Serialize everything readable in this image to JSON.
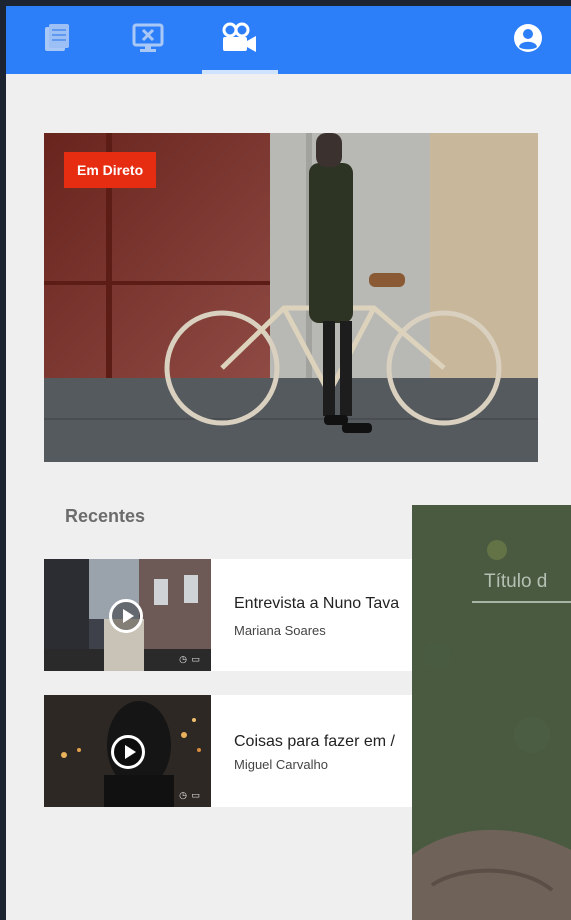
{
  "nav": {
    "tabs": [
      {
        "icon": "document-icon"
      },
      {
        "icon": "screen-icon"
      },
      {
        "icon": "video-camera-icon"
      }
    ],
    "profile_icon": "user-circle-icon",
    "accent": "#2d7ff9"
  },
  "hero": {
    "badge": "Em Direto",
    "badge_color": "#e62d12"
  },
  "recent": {
    "title": "Recentes",
    "items": [
      {
        "title": "Entrevista a Nuno Tava",
        "author": "Mariana Soares",
        "meta": "◷ ▭"
      },
      {
        "title": "Coisas para fazer em /",
        "author": "Miguel Carvalho",
        "meta": "◷ ▭"
      }
    ]
  },
  "overlay": {
    "field_label": "Título d"
  }
}
